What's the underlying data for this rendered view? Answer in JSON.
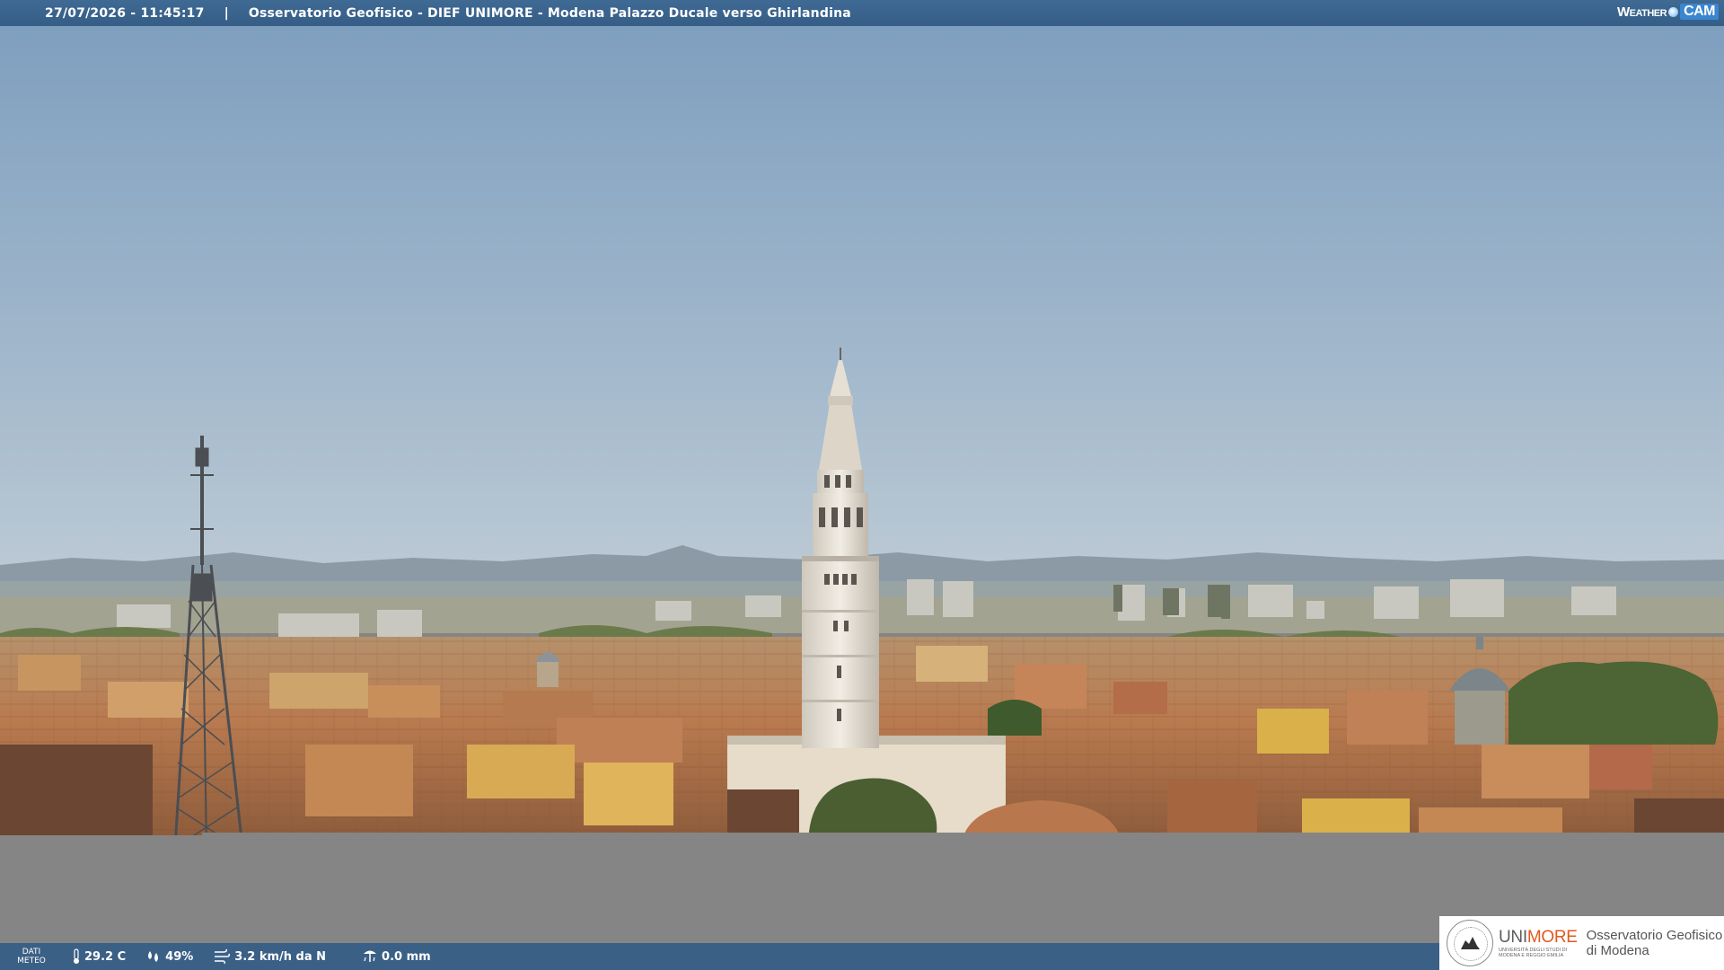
{
  "header": {
    "datetime": "27/07/2026 - 11:45:17",
    "separator": "|",
    "camera_title": "Osservatorio Geofisico - DIEF UNIMORE - Modena Palazzo Ducale verso Ghirlandina",
    "brand_weather": "Weather",
    "brand_cam": "CAM"
  },
  "footer": {
    "dati_line1": "DATI",
    "dati_line2": "METEO",
    "temperature": "29.2 C",
    "humidity": "49%",
    "wind": "3.2 km/h da N",
    "rain": "0.0 mm",
    "icons": {
      "temperature": "thermometer-icon",
      "humidity": "droplets-icon",
      "wind": "wind-icon",
      "rain": "rain-gauge-icon"
    }
  },
  "logo": {
    "unimore_uni": "UNI",
    "unimore_more": "MORE",
    "unimore_sub1": "UNIVERSITÀ DEGLI STUDI DI",
    "unimore_sub2": "MODENA E REGGIO EMILIA",
    "observatory_line1": "Osservatorio Geofisico",
    "observatory_line2": "di Modena"
  },
  "colors": {
    "topbar": "#3f6a94",
    "bottombar": "#3b6086",
    "background": "#858585",
    "accent_more": "#e05a20",
    "brand_cam": "#3a86cf"
  }
}
